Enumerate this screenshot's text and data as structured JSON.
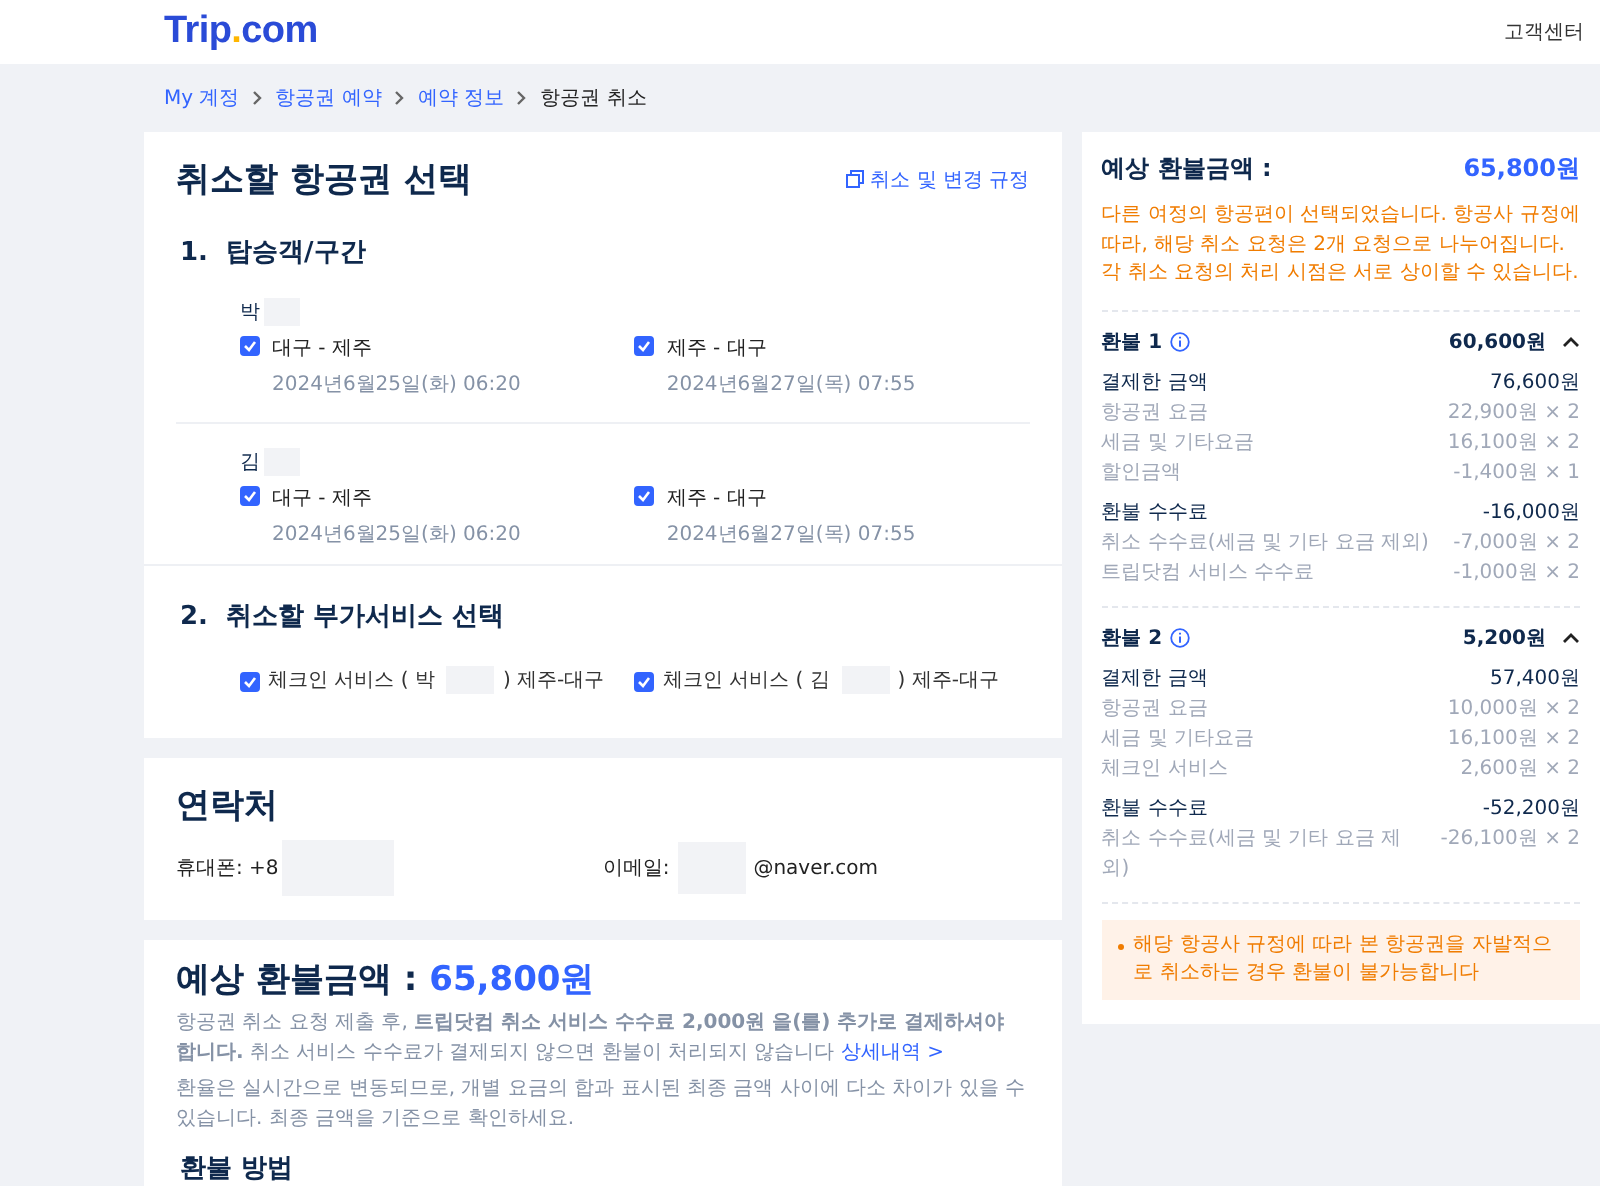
{
  "header": {
    "logo_main": "Trip",
    "logo_dot": ".",
    "logo_tail": "com",
    "support": "고객센터"
  },
  "breadcrumb": [
    {
      "label": "My 계정",
      "current": false
    },
    {
      "label": "항공권 예약",
      "current": false
    },
    {
      "label": "예약 정보",
      "current": false
    },
    {
      "label": "항공권 취소",
      "current": true
    }
  ],
  "select_card": {
    "title": "취소할 항공권 선택",
    "policy_link": "취소 및 변경 규정",
    "section1": {
      "number": "1.",
      "title": "탑승객/구간"
    },
    "passengers": [
      {
        "name": "박",
        "segments": [
          {
            "route": "대구 - 제주",
            "date": "2024년6월25일(화) 06:20",
            "checked": true
          },
          {
            "route": "제주 - 대구",
            "date": "2024년6월27일(목) 07:55",
            "checked": true
          }
        ]
      },
      {
        "name": "김",
        "segments": [
          {
            "route": "대구 - 제주",
            "date": "2024년6월25일(화) 06:20",
            "checked": true
          },
          {
            "route": "제주 - 대구",
            "date": "2024년6월27일(목) 07:55",
            "checked": true
          }
        ]
      }
    ],
    "section2": {
      "number": "2.",
      "title": "취소할 부가서비스 선택"
    },
    "services": [
      {
        "label_before": "체크인 서비스 ( 박",
        "label_after": ") 제주-대구",
        "checked": true
      },
      {
        "label_before": "체크인 서비스 ( 김",
        "label_after": ") 제주-대구",
        "checked": true
      }
    ]
  },
  "contact_card": {
    "title": "연락처",
    "phone_label": "휴대폰: +8",
    "email_label": "이메일:",
    "email_tail": "@naver.com"
  },
  "refund_card": {
    "title": "예상 환불금액 :",
    "amount": "65,800원",
    "notice": "항공권 취소 요청 제출 후, **트립닷컴 취소 서비스 수수료 2,000원 을(를) 추가로 결제하셔야 합니다.** 취소 서비스 수수료가 결제되지 않으면 환불이 처리되지 않습니다",
    "details_link": "상세내역 >",
    "note": "환율은 실시간으로 변동되므로, 개별 요금의 합과 표시된 최종 금액 사이에 다소 차이가 있을 수 있습니다. 최종 금액을 기준으로 확인하세요.",
    "method_title": "환불 방법"
  },
  "summary": {
    "title": "예상 환불금액 :",
    "amount": "65,800원",
    "warning": "다른 여정의 항공편이 선택되었습니다. 항공사 규정에 따라, 해당 취소 요청은 2개 요청으로 나누어집니다. 각 취소 요청의 처리 시점은 서로 상이할 수 있습니다.",
    "refunds": [
      {
        "title": "환불 1",
        "amount": "60,600원",
        "expanded": true,
        "groups": [
          {
            "label": "결제한 금액",
            "value": "76,600원",
            "items": [
              {
                "label": "항공권 요금",
                "value": "22,900원 × 2"
              },
              {
                "label": "세금 및 기타요금",
                "value": "16,100원 × 2"
              },
              {
                "label": "할인금액",
                "value": "-1,400원 × 1"
              }
            ]
          },
          {
            "label": "환불 수수료",
            "value": "-16,000원",
            "items": [
              {
                "label": "취소 수수료(세금 및 기타 요금 제외)",
                "value": "-7,000원 × 2"
              },
              {
                "label": "트립닷컴 서비스 수수료",
                "value": "-1,000원 × 2"
              }
            ]
          }
        ]
      },
      {
        "title": "환불 2",
        "amount": "5,200원",
        "expanded": true,
        "groups": [
          {
            "label": "결제한 금액",
            "value": "57,400원",
            "items": [
              {
                "label": "항공권 요금",
                "value": "10,000원 × 2"
              },
              {
                "label": "세금 및 기타요금",
                "value": "16,100원 × 2"
              },
              {
                "label": "체크인 서비스",
                "value": "2,600원 × 2"
              }
            ]
          },
          {
            "label": "환불 수수료",
            "value": "-52,200원",
            "items": [
              {
                "label": "취소 수수료(세금 및 기타 요금 제외)",
                "value": "-26,100원 × 2"
              }
            ]
          }
        ]
      }
    ],
    "alert": "해당 항공사 규정에 따라 본 항공권을 자발적으로 취소하는 경우 환불이 불가능합니다"
  }
}
